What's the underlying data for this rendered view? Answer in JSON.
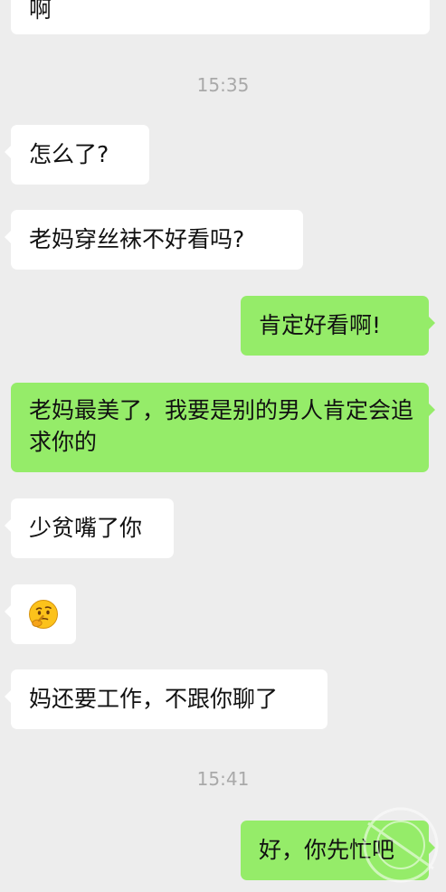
{
  "messages": [
    {
      "from": "other",
      "text": "啊"
    },
    {
      "from": "other",
      "text": "怎么了?"
    },
    {
      "from": "other",
      "text": "老妈穿丝袜不好看吗?"
    },
    {
      "from": "me",
      "text": "肯定好看啊!"
    },
    {
      "from": "me",
      "text": "老妈最美了，我要是别的男人肯定会追求你的"
    },
    {
      "from": "other",
      "text": "少贫嘴了你"
    },
    {
      "from": "other",
      "emoji": "thinking-face"
    },
    {
      "from": "other",
      "text": "妈还要工作，不跟你聊了"
    },
    {
      "from": "me",
      "text": "好，你先忙吧"
    }
  ],
  "timestamps": [
    "15:35",
    "15:41"
  ],
  "colors": {
    "background": "#ededed",
    "incoming_bubble": "#ffffff",
    "outgoing_bubble": "#95ec69",
    "timestamp": "#a9a9a9"
  }
}
